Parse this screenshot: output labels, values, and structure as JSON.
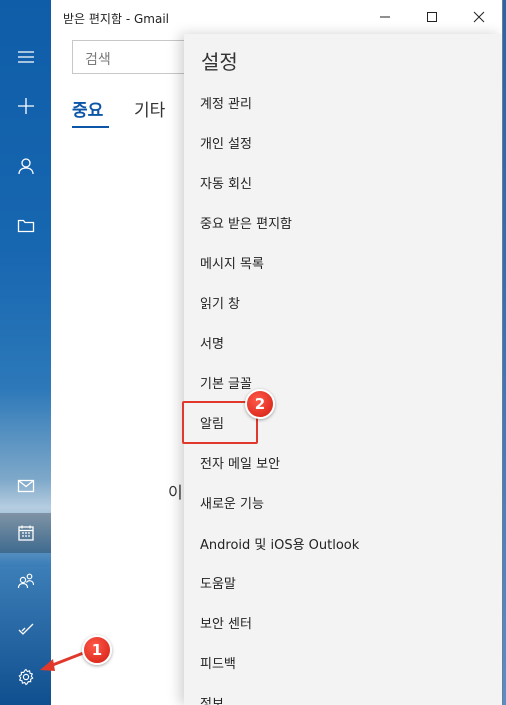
{
  "window": {
    "title": "받은 편지함 - Gmail"
  },
  "search": {
    "placeholder": "검색"
  },
  "tabs": {
    "focused": "중요",
    "other": "기타"
  },
  "empty_text": "이",
  "settings": {
    "title": "설정",
    "items": [
      "계정 관리",
      "개인 설정",
      "자동 회신",
      "중요 받은 편지함",
      "메시지 목록",
      "읽기 창",
      "서명",
      "기본 글꼴",
      "알림",
      "전자 메일 보안",
      "새로운 기능",
      "Android 및 iOS용 Outlook",
      "도움말",
      "보안 센터",
      "피드백",
      "정보"
    ]
  },
  "callouts": {
    "one": "1",
    "two": "2"
  },
  "colors": {
    "accent": "#0b56a6",
    "callout": "#e0392b"
  },
  "icons": {
    "rail": [
      "hamburger-icon",
      "new-mail-icon",
      "account-icon",
      "folder-icon",
      "mail-icon",
      "calendar-icon",
      "people-icon",
      "todo-icon",
      "settings-icon"
    ]
  }
}
